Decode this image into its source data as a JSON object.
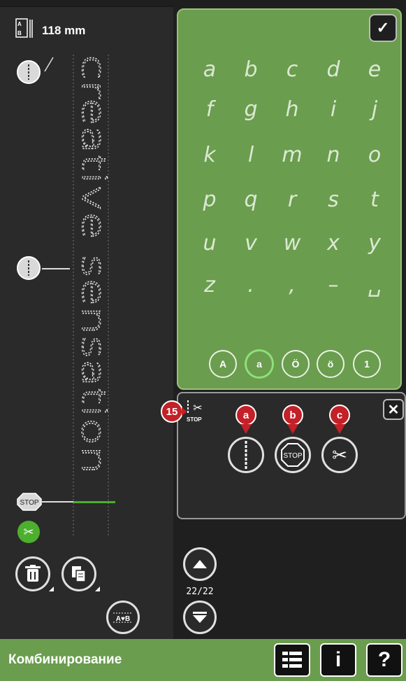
{
  "header": {
    "stitch_length": "118 mm"
  },
  "preview": {
    "sample_text": "creative sensation"
  },
  "keyboard": {
    "rows": [
      [
        "a",
        "b",
        "c",
        "d",
        "e"
      ],
      [
        "f",
        "g",
        "h",
        "i",
        "j"
      ],
      [
        "k",
        "l",
        "m",
        "n",
        "o"
      ],
      [
        "p",
        "q",
        "r",
        "s",
        "t"
      ],
      [
        "u",
        "v",
        "w",
        "x",
        "y"
      ],
      [
        "z",
        ".",
        ",",
        "–",
        "␣"
      ]
    ],
    "case_buttons": [
      "A",
      "a",
      "Ö",
      "ö",
      "1"
    ],
    "active_case": "a"
  },
  "tools": {
    "callout_number": "15",
    "callouts": [
      "a",
      "b",
      "c"
    ],
    "stop_label": "STOP",
    "header_icon_label": "STOP"
  },
  "pager": {
    "page": "22/22"
  },
  "left_markers": {
    "stop_label": "STOP"
  },
  "footer": {
    "title": "Комбинирование",
    "info_label": "i",
    "help_label": "?"
  },
  "colors": {
    "accent_green": "#6a9d4e",
    "callout_red": "#c32027",
    "active_line": "#4caf2e"
  }
}
